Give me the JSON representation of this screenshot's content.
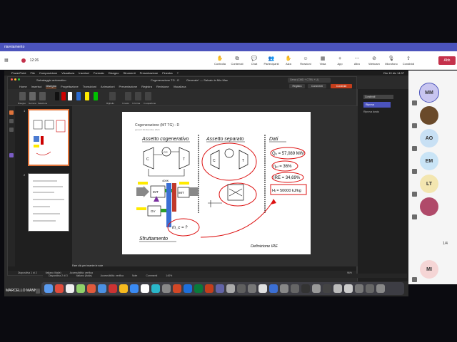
{
  "teams": {
    "window_title": "riavviamento",
    "timer": "12:26",
    "actions": [
      {
        "label": "Controlla",
        "icon": "control-icon",
        "glyph": "✋"
      },
      {
        "label": "Contenuti",
        "icon": "share-icon",
        "glyph": "⧉"
      },
      {
        "label": "Chat",
        "icon": "chat-icon",
        "glyph": "💬"
      },
      {
        "label": "Partecipanti",
        "icon": "people-icon",
        "glyph": "👥"
      },
      {
        "label": "Alza",
        "icon": "raise-hand-icon",
        "glyph": "✋"
      },
      {
        "label": "Reazioni",
        "icon": "reaction-icon",
        "glyph": "☺"
      },
      {
        "label": "Vista",
        "icon": "view-icon",
        "glyph": "▦"
      },
      {
        "label": "App",
        "icon": "apps-icon",
        "glyph": "+"
      },
      {
        "label": "Altro",
        "icon": "more-icon",
        "glyph": "⋯"
      },
      {
        "label": "Webcam",
        "icon": "camera-off-icon",
        "glyph": "⊘"
      },
      {
        "label": "Microfono",
        "icon": "mic-off-icon",
        "glyph": "🎙"
      },
      {
        "label": "Condividi",
        "icon": "share-screen-icon",
        "glyph": "⇧"
      }
    ],
    "leave_label": "Abb"
  },
  "participants": [
    {
      "initials": "MM",
      "color": "#c8c5f0"
    },
    {
      "initials": "",
      "color": "#6a4a2a"
    },
    {
      "initials": "AO",
      "color": "#c8e0f4"
    },
    {
      "initials": "EM",
      "color": "#c9e4f6"
    },
    {
      "initials": "LT",
      "color": "#f3e6b0"
    },
    {
      "initials": "",
      "color": "#b04a6a"
    },
    {
      "initials": "MI",
      "color": "#f5d5d5"
    }
  ],
  "pager": "1/4",
  "mac": {
    "menu": [
      "PowerPoint",
      "File",
      "Composizione",
      "Visualizza",
      "Inserisci",
      "Formato",
      "Disegno",
      "Strumenti",
      "Presentazione",
      "Finestra",
      "?"
    ],
    "clock": "Dio 19 dic 14:37"
  },
  "ppt": {
    "autosave": "Salvataggio automatico",
    "title": "Cogenerazione TG - D",
    "title_right": "Generale* — Salvato in Mio Mac",
    "search": "Cerca (CMD + CTRL + U)",
    "tabs": [
      "Home",
      "Inserisci",
      "Disegno",
      "Progettazione",
      "Transizioni",
      "Animazioni",
      "Presentazione",
      "Registra",
      "Revisione",
      "Visualizza"
    ],
    "active_tab": "Disegno",
    "registra": "Registra",
    "commenti": "Commenti",
    "condividi": "Condividi",
    "tool_labels": [
      "Disegno",
      "Gomma",
      "Selezione",
      "Righello",
      "In testo",
      "In forma",
      "In equazione"
    ],
    "slide_numbers": [
      "1",
      "2"
    ],
    "notes_hint": "Fare clic per inserire le note",
    "status": [
      "Diapositiva 1 di 2",
      "Italiano (Italia)",
      "Accessibilità: verifica"
    ],
    "zoom": "96%",
    "back_status": [
      "Diapositiva 2 di 3",
      "Italiano (Italia)",
      "Accessibilità: verifica",
      "Note",
      "Commenti",
      "140%"
    ],
    "side_tab": "Condividi",
    "side_blue": "Riprova",
    "side_text": "Riprova lancio"
  },
  "slide": {
    "title": "Cogenerazione (MT TG) - D",
    "date": "giovedì 19 dicembre 2024",
    "heading1": "Assetto cogenerativo",
    "heading2": "Assetto separato",
    "heading3": "Dati",
    "eq1": "Q̇ₑ = 57,089 MW",
    "eq2": "ηₑₗ = 36%",
    "eq3": "IRE = 34,69%",
    "eq4": "Hᵢ = 50000 kJ/kg",
    "note1": "Sfruttamento",
    "note2": "Definizione IRE",
    "mdot": "ṁ_c = ?",
    "lbl_c": "C",
    "lbl_t": "T",
    "lbl_cc": "CC",
    "lbl_imt": "IMT",
    "lbl_ug": "GV"
  },
  "presenter": "MARCELLO MANNA"
}
